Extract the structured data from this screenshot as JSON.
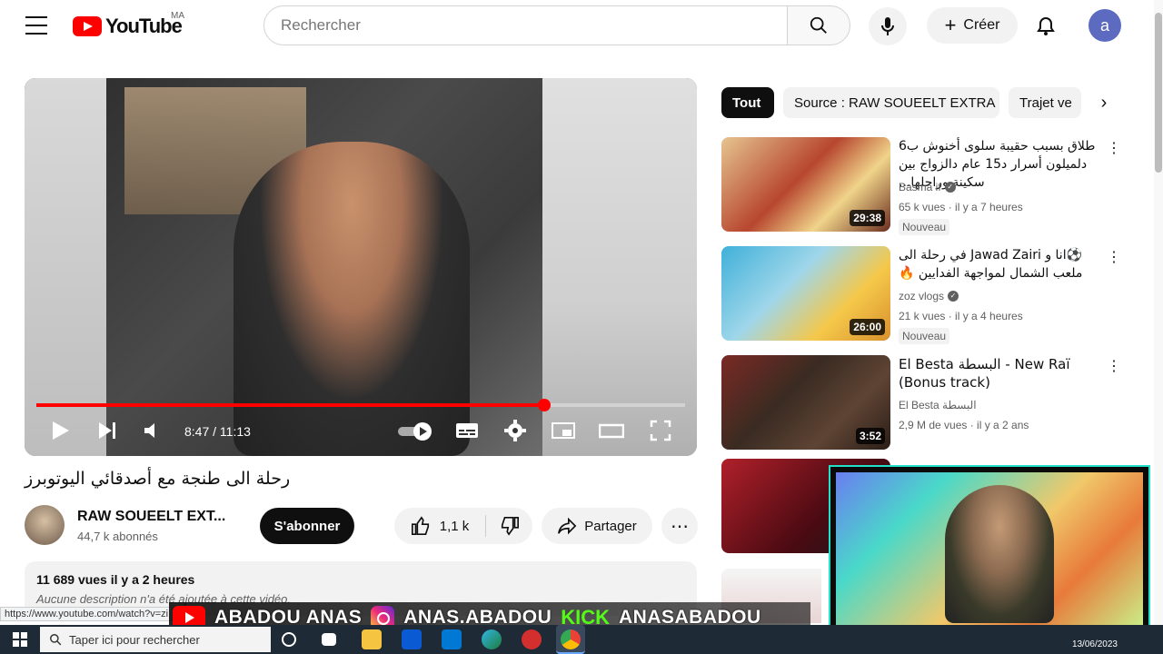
{
  "header": {
    "logo_text": "YouTube",
    "country": "MA",
    "search_placeholder": "Rechercher",
    "create_label": "Créer",
    "avatar_letter": "a"
  },
  "player": {
    "time": "8:47 / 11:13",
    "progress_fraction": 0.7825
  },
  "video": {
    "title": "رحلة الى طنجة مع أصدقائي اليوتوبرز",
    "channel": "RAW SOUEELT EXT...",
    "subscribers": "44,7 k abonnés",
    "subscribe_label": "S'abonner",
    "likes": "1,1 k",
    "share_label": "Partager",
    "description_stats": "11 689 vues  il y a 2 heures",
    "description_text": "Aucune description n'a été ajoutée à cette vidéo."
  },
  "chips": [
    {
      "label": "Tout",
      "active": true
    },
    {
      "label": "Source : RAW SOUEELT EXTRA",
      "active": false
    },
    {
      "label": "Trajet ve",
      "active": false
    }
  ],
  "recommendations": [
    {
      "title": "طلاق بسبب حقيبة سلوى أخنوش ب6 دلميلون أسرار د15 عام دالزواج بين سكينة وراجلها...",
      "channel": "Basma if",
      "verified": true,
      "meta": "65 k vues · il y a 7 heures",
      "badge": "Nouveau",
      "duration": "29:38"
    },
    {
      "title": "⚽انا و Jawad Zairi في رحلة الى ملعب الشمال لمواجهة الفدايين 🔥",
      "channel": "zoz vlogs",
      "verified": true,
      "meta": "21 k vues · il y a 4 heures",
      "badge": "Nouveau",
      "duration": "26:00"
    },
    {
      "title": "El Besta البسطة - New Raï (Bonus track)",
      "channel": "El Besta البسطة",
      "verified": false,
      "meta": "2,9 M de vues · il y a 2 ans",
      "badge": "",
      "duration": "3:52"
    }
  ],
  "overlay": {
    "yt_name": "ABADOU ANAS",
    "ig_name": "ANAS.ABADOU",
    "kick_label": "KICK",
    "kick_name": "ANASABADOU"
  },
  "status_url": "https://www.youtube.com/watch?v=zi",
  "taskbar": {
    "search_placeholder": "Taper ici pour rechercher",
    "date": "13/06/2023"
  },
  "colors": {
    "brand_red": "#ff0000",
    "accent_dark": "#0f0f0f",
    "chip_bg": "#f2f2f2",
    "avatar_bg": "#5c6bc0",
    "kick_green": "#53fc18"
  }
}
